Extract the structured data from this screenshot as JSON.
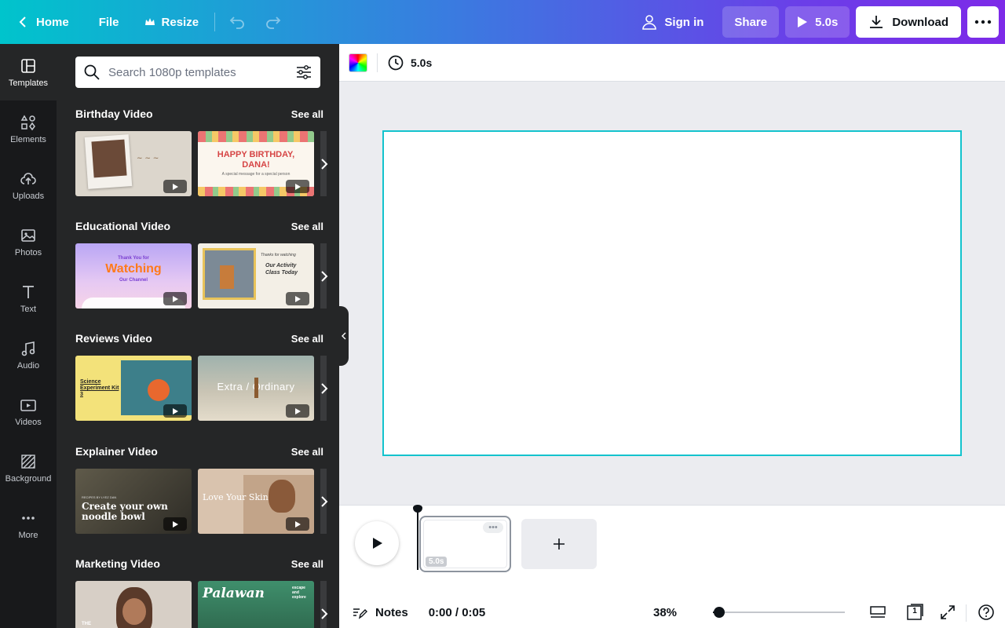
{
  "topbar": {
    "home": "Home",
    "file": "File",
    "resize": "Resize",
    "sign_in": "Sign in",
    "share": "Share",
    "play_duration": "5.0s",
    "download": "Download"
  },
  "rail": {
    "templates": "Templates",
    "elements": "Elements",
    "uploads": "Uploads",
    "photos": "Photos",
    "text": "Text",
    "audio": "Audio",
    "videos": "Videos",
    "background": "Background",
    "more": "More"
  },
  "panel": {
    "search_placeholder": "Search 1080p templates",
    "see_all": "See all",
    "sections": [
      {
        "title": "Birthday Video"
      },
      {
        "title": "Educational Video"
      },
      {
        "title": "Reviews Video"
      },
      {
        "title": "Explainer Video"
      },
      {
        "title": "Marketing Video"
      }
    ],
    "thumb_text": {
      "birthday_2": "HAPPY BIRTHDAY, DANA!",
      "birthday_2_sub": "A special message for a special person",
      "edu_1_small": "Thank You for",
      "edu_1": "Watching",
      "edu_1_sub": "Our Channel",
      "edu_2_a": "Thanks for watching",
      "edu_2_b": "Our Activity Class Today",
      "rev_1": "Science Experiment Kit 3",
      "rev_2": "Extra / Ordinary",
      "exp_1_small": "RECIPES BY LYEZ DAN",
      "exp_1": "Create your own noodle bowl",
      "exp_2": "Love Your Skin",
      "mkt_1": "THE",
      "mkt_2": "Palawan",
      "mkt_2_side": "escape and explore"
    }
  },
  "editor": {
    "duration": "5.0s"
  },
  "timeline": {
    "clip_duration": "5.0s",
    "clip_more": "•••"
  },
  "bottombar": {
    "notes": "Notes",
    "time": "0:00 / 0:05",
    "zoom": "38%",
    "zoom_level": 0.05,
    "page_count": "1"
  },
  "colors": {
    "accent": "#13c3cd",
    "rail_bg": "#18191b",
    "panel_bg": "#252627"
  }
}
